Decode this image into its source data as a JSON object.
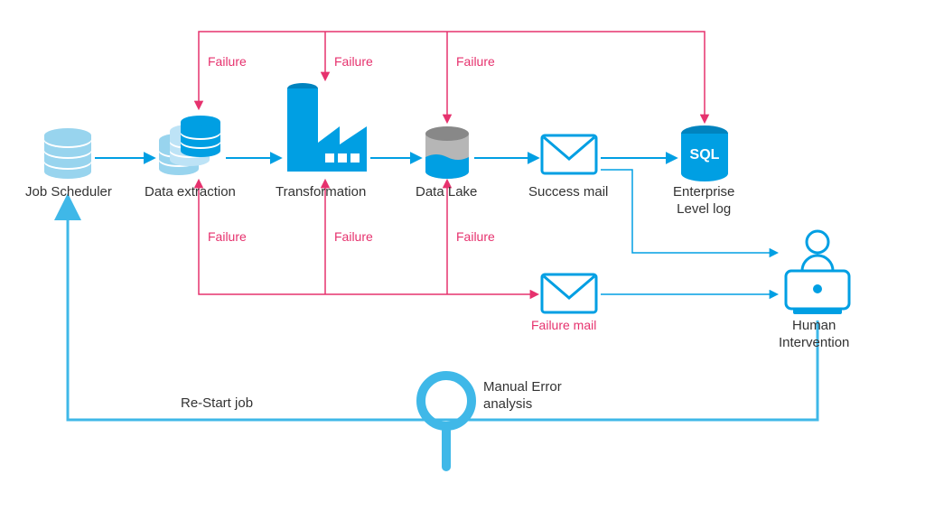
{
  "nodes": {
    "jobScheduler": "Job Scheduler",
    "dataExtraction": "Data extraction",
    "transformation": "Transformation",
    "dataLake": "Data Lake",
    "successMail": "Success mail",
    "enterpriseLog": "Enterprise\nLevel log",
    "failureMail": "Failure mail",
    "humanIntervention": "Human\nIntervention",
    "manualError": "Manual Error\nanalysis",
    "restart": "Re-Start job",
    "sql": "SQL"
  },
  "failure": "Failure",
  "colors": {
    "accent": "#009fe3",
    "accentDark": "#0083be",
    "light": "#98d4ee",
    "fail": "#e6326e",
    "grey": "#b6b6b6"
  }
}
